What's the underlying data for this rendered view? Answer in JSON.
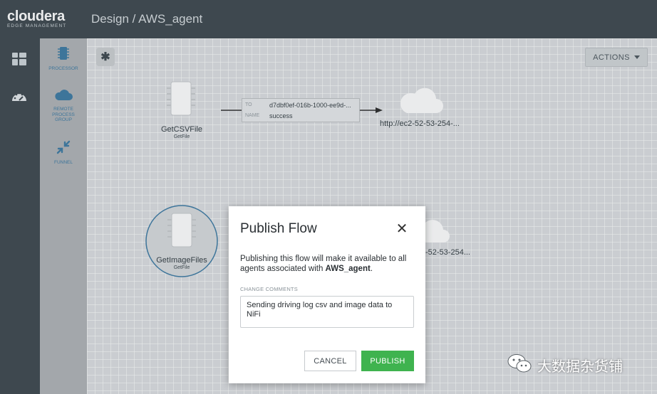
{
  "header": {
    "logo_text": "cloudera",
    "logo_subtext": "EDGE MANAGEMENT",
    "page_title": "Design / AWS_agent"
  },
  "leftnav": {
    "items": [
      {
        "icon": "dashboard-grid-icon"
      },
      {
        "icon": "gauge-icon"
      }
    ]
  },
  "palette": {
    "items": [
      {
        "label": "PROCESSOR",
        "icon": "processor-chip-icon"
      },
      {
        "label": "REMOTE PROCESS GROUP",
        "icon": "cloud-icon"
      },
      {
        "label": "FUNNEL",
        "icon": "funnel-arrows-icon"
      }
    ]
  },
  "toolbar": {
    "actions_label": "ACTIONS"
  },
  "canvas": {
    "processors": [
      {
        "name": "GetCSVFile",
        "type": "GetFile"
      },
      {
        "name": "GetImageFiles",
        "type": "GetFile"
      }
    ],
    "connection": {
      "to_key": "TO",
      "to_value": "d7dbf0ef-016b-1000-ee9d-...",
      "name_key": "NAME",
      "name_value": "success"
    },
    "remote_groups": [
      {
        "url": "http://ec2-52-53-254-..."
      },
      {
        "url": "-52-53-254..."
      }
    ]
  },
  "modal": {
    "title": "Publish Flow",
    "description_prefix": "Publishing this flow will make it available to all agents associated with ",
    "description_agent": "AWS_agent",
    "description_suffix": ".",
    "comments_label": "CHANGE COMMENTS",
    "comments_value": "Sending driving log csv and image data to NiFi",
    "cancel_label": "CANCEL",
    "publish_label": "PUBLISH",
    "close_symbol": "✕"
  },
  "watermark": {
    "text": "大数据杂货铺"
  },
  "colors": {
    "topbar": "#2e3940",
    "palette": "#a9adb0",
    "accent_blue": "#2d6f9c",
    "publish_green": "#3fb34f"
  }
}
